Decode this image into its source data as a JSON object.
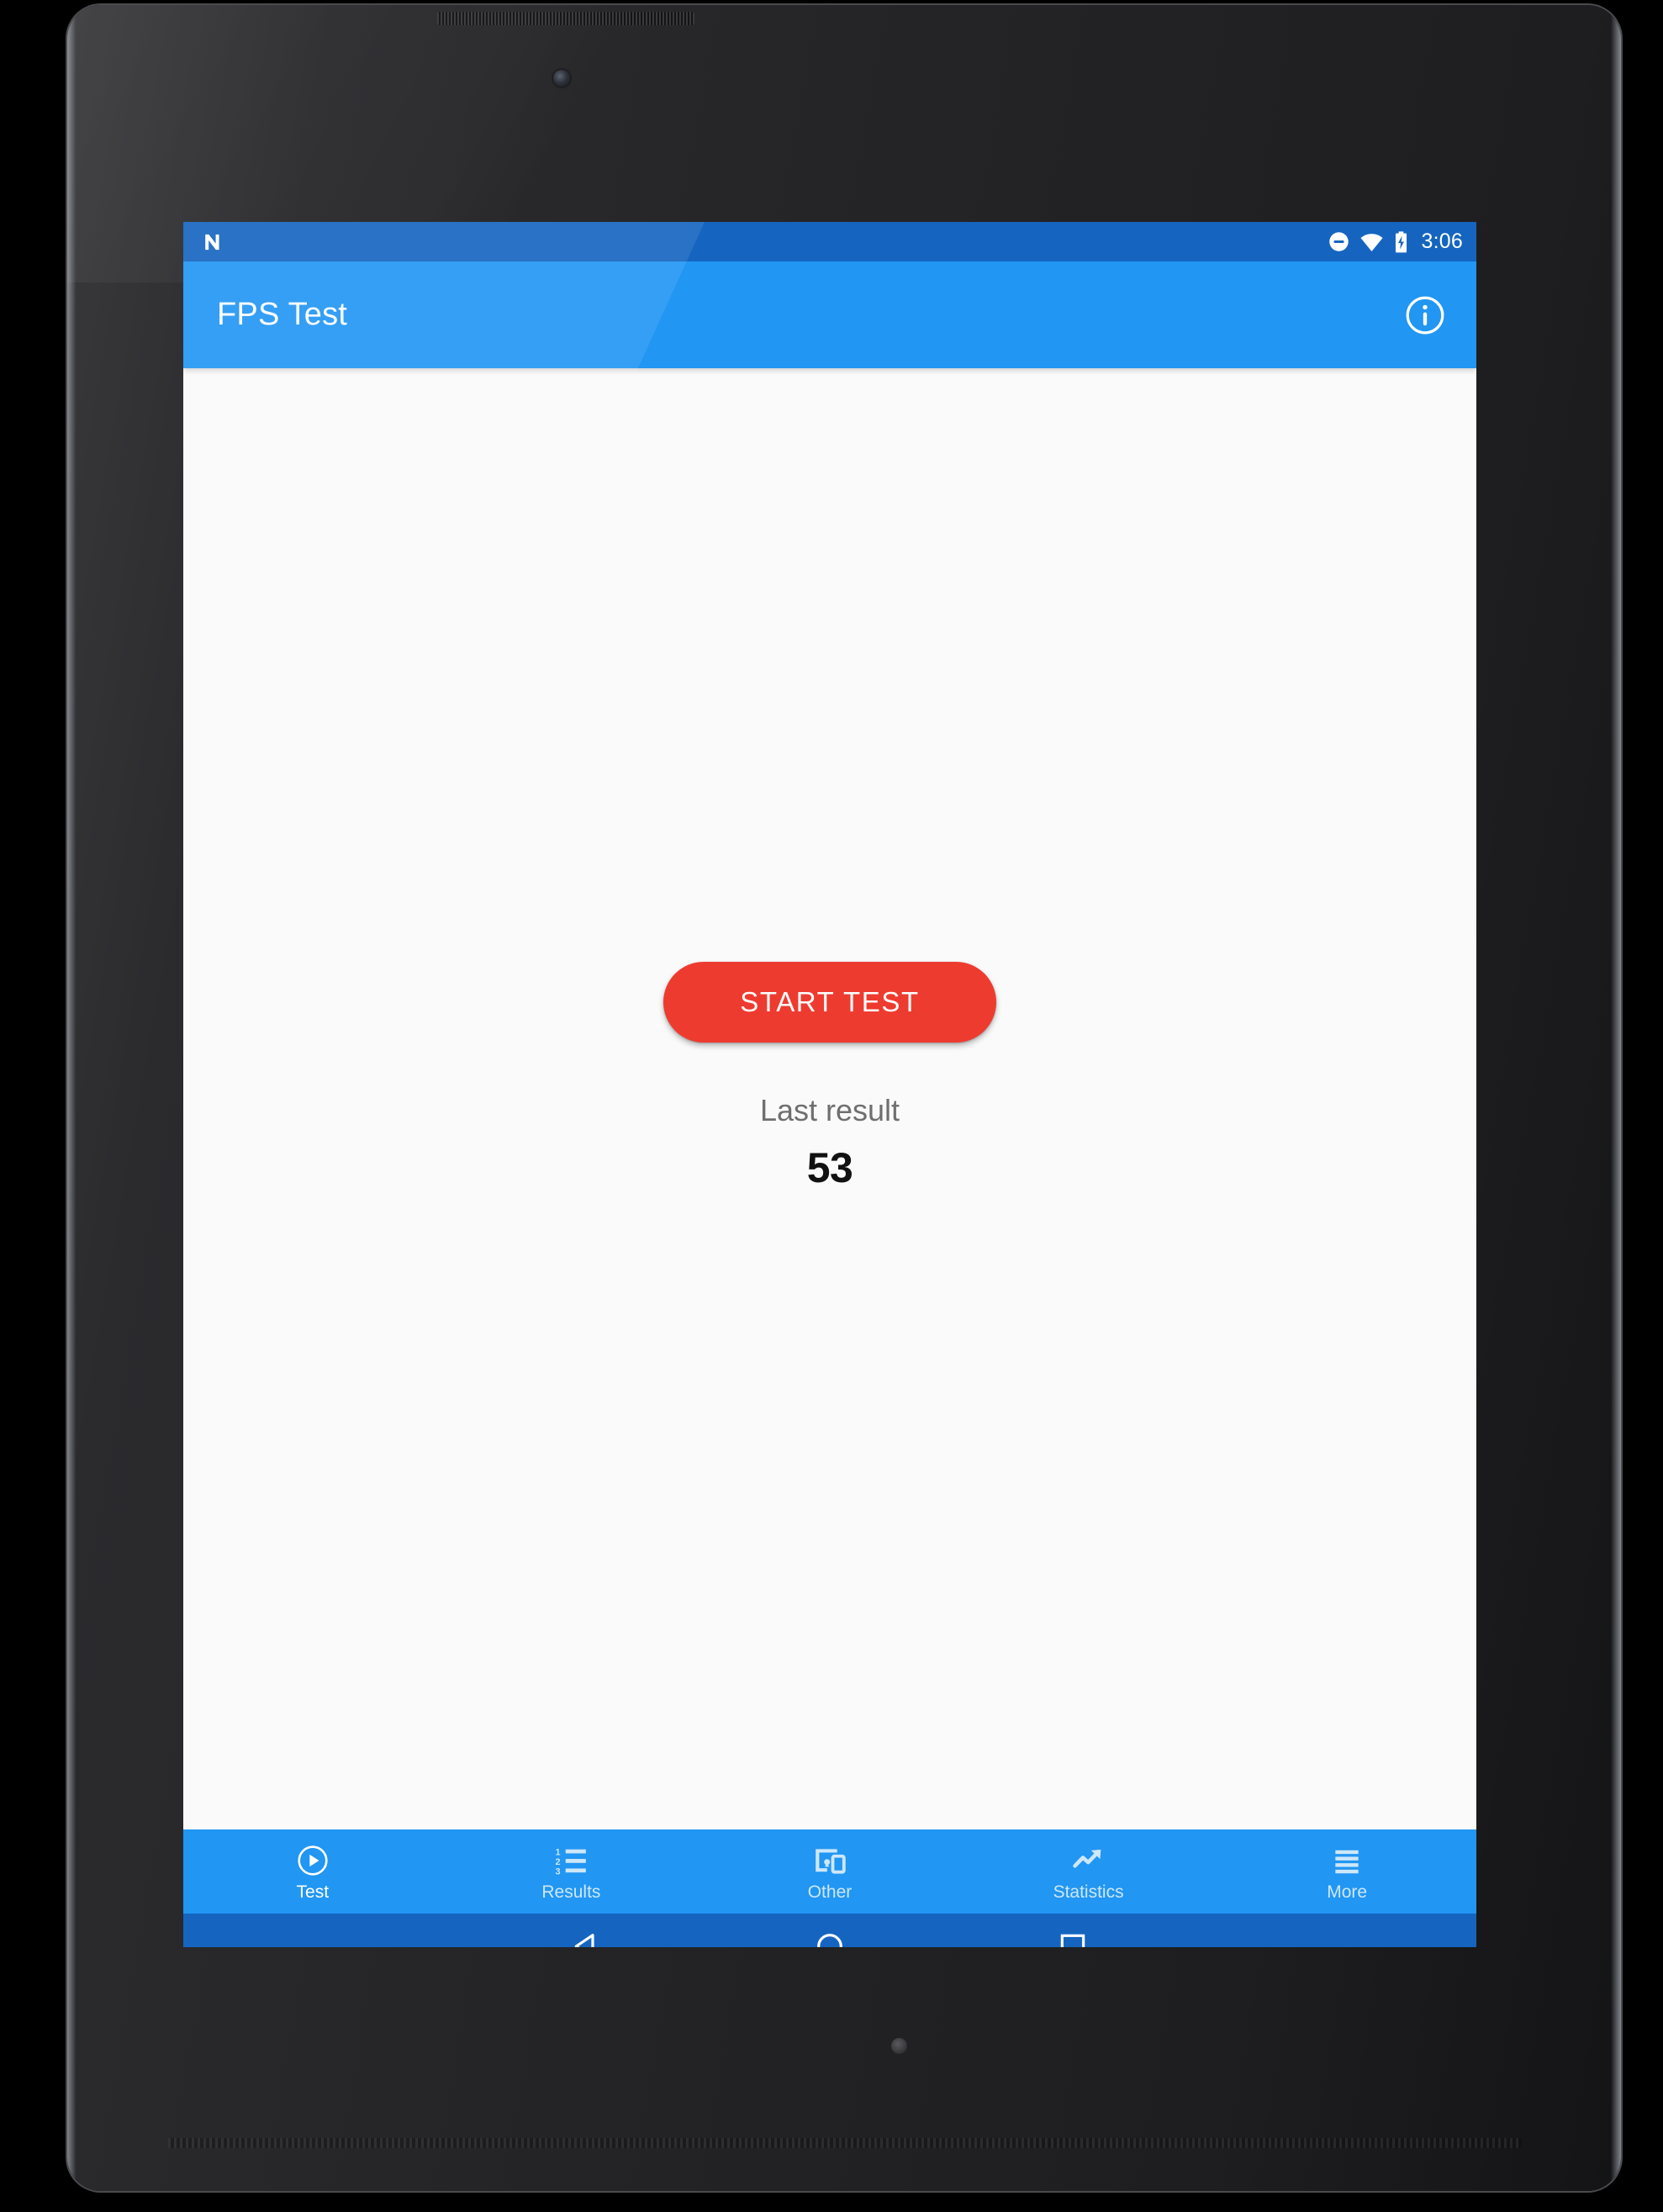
{
  "device": {
    "type": "android-tablet",
    "bezel_color": "#262628",
    "backdrop_color": "#000000"
  },
  "status_bar": {
    "background": "#1565C0",
    "os_logo": "nougat-n-logo",
    "icons": [
      "do-not-disturb-icon",
      "wifi-icon",
      "battery-charging-icon"
    ],
    "time": "3:06"
  },
  "app_bar": {
    "background": "#2196F3",
    "title": "FPS Test",
    "action_icon": "info-icon"
  },
  "content": {
    "background": "#FAFAFB",
    "start_button_label": "START TEST",
    "start_button_color": "#EE3B2F",
    "last_result_label": "Last result",
    "last_result_value": "53"
  },
  "bottom_nav": {
    "background": "#2196F3",
    "active_color": "#FFFFFF",
    "inactive_color": "#CDE7FB",
    "items": [
      {
        "label": "Test",
        "icon": "play-circle-icon",
        "active": true
      },
      {
        "label": "Results",
        "icon": "numbered-list-icon",
        "active": false
      },
      {
        "label": "Other",
        "icon": "devices-icon",
        "active": false
      },
      {
        "label": "Statistics",
        "icon": "trending-up-icon",
        "active": false
      },
      {
        "label": "More",
        "icon": "hamburger-menu-icon",
        "active": false
      }
    ]
  },
  "system_nav": {
    "background": "#1565C0",
    "buttons": [
      {
        "name": "back-button",
        "icon": "back-triangle-icon"
      },
      {
        "name": "home-button",
        "icon": "home-circle-icon"
      },
      {
        "name": "recents-button",
        "icon": "recents-square-icon"
      }
    ]
  }
}
